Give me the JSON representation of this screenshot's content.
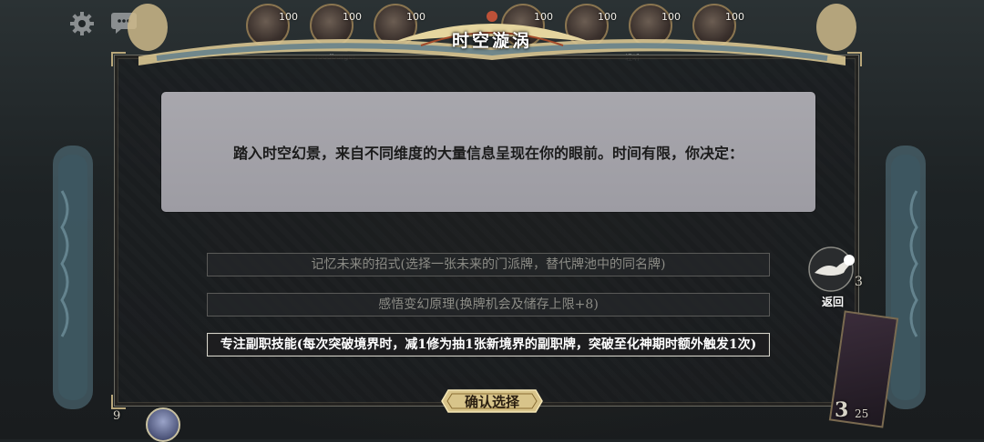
{
  "header": {
    "title": "时空漩涡"
  },
  "players": [
    {
      "hp": "100",
      "name": ""
    },
    {
      "hp": "100",
      "name": "roodburger"
    },
    {
      "hp": "100",
      "name": ""
    },
    {
      "hp": "100",
      "name": ""
    },
    {
      "hp": "100",
      "name": "轻听"
    },
    {
      "hp": "100",
      "name": ""
    },
    {
      "hp": "100",
      "name": ""
    }
  ],
  "dialog": {
    "message": "踏入时空幻景，来自不同维度的大量信息呈现在你的眼前。时间有限，你决定：",
    "options": [
      {
        "label": "记忆未来的招式(选择一张未来的门派牌，替代牌池中的同名牌)",
        "selected": false
      },
      {
        "label": "感悟变幻原理(换牌机会及储存上限+8)",
        "selected": false
      },
      {
        "label": "专注副职技能(每次突破境界时，减1修为抽1张新境界的副职牌，突破至化神期时额外触发1次)",
        "selected": true
      }
    ],
    "confirm_label": "确认选择"
  },
  "side": {
    "return_label": "返回",
    "return_count": "3",
    "deck_count": "3",
    "deck_total": "25",
    "bottom_left_count": "9"
  },
  "colors": {
    "message_box": "#a8a7ad",
    "selected_border": "#d8d6cc",
    "gold": "#d8c48a"
  },
  "icons": {
    "settings": "gear-icon",
    "chat": "chat-bubble-icon",
    "return": "crane-return-icon"
  }
}
